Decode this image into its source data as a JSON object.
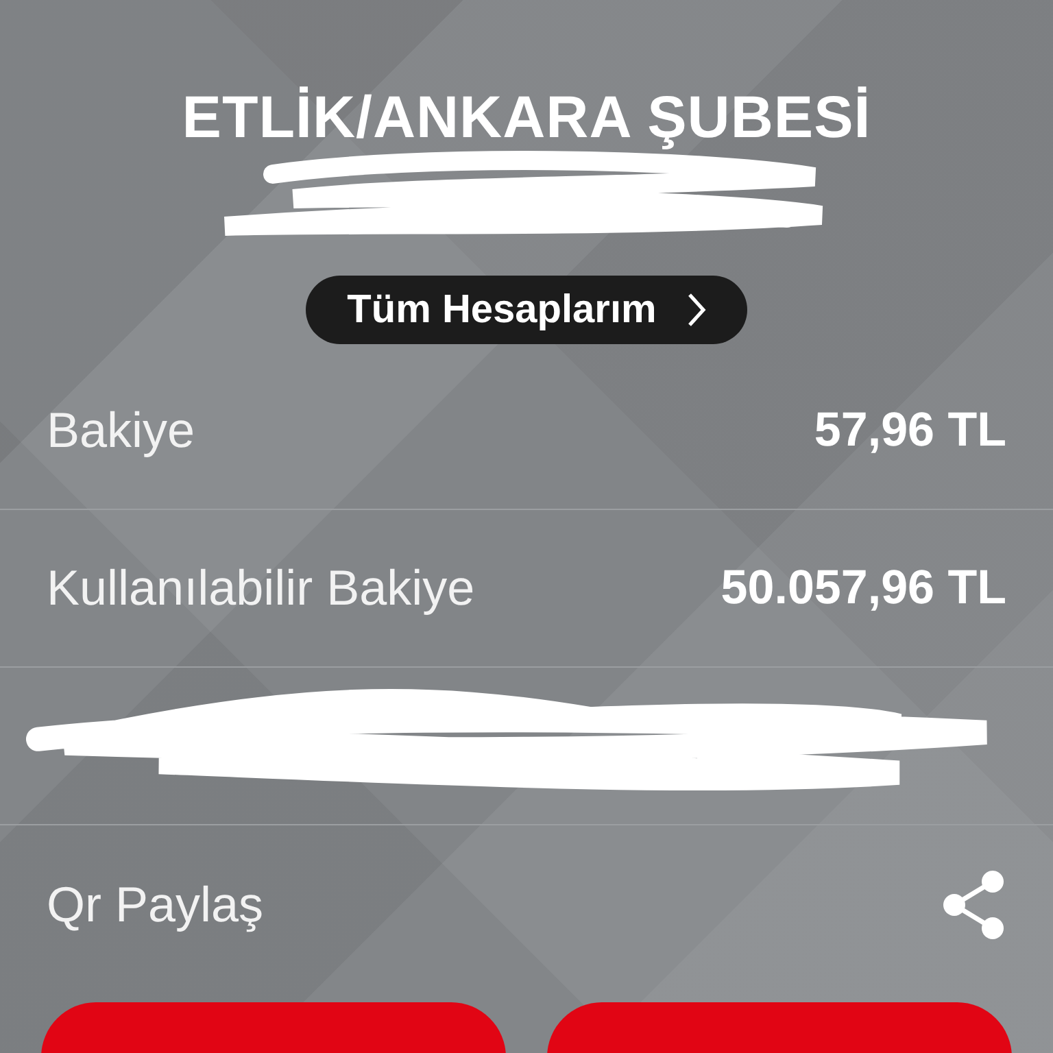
{
  "branch": {
    "title": "ETLİK/ANKARA ŞUBESİ",
    "redacted": true
  },
  "accounts_button": {
    "label": "Tüm Hesaplarım"
  },
  "rows": [
    {
      "kind": "value",
      "label": "Bakiye",
      "value": "57,96 TL"
    },
    {
      "kind": "value",
      "label": "Kullanılabilir Bakiye",
      "value": "50.057,96 TL"
    },
    {
      "kind": "redacted"
    },
    {
      "kind": "share",
      "label": "Qr Paylaş"
    }
  ]
}
